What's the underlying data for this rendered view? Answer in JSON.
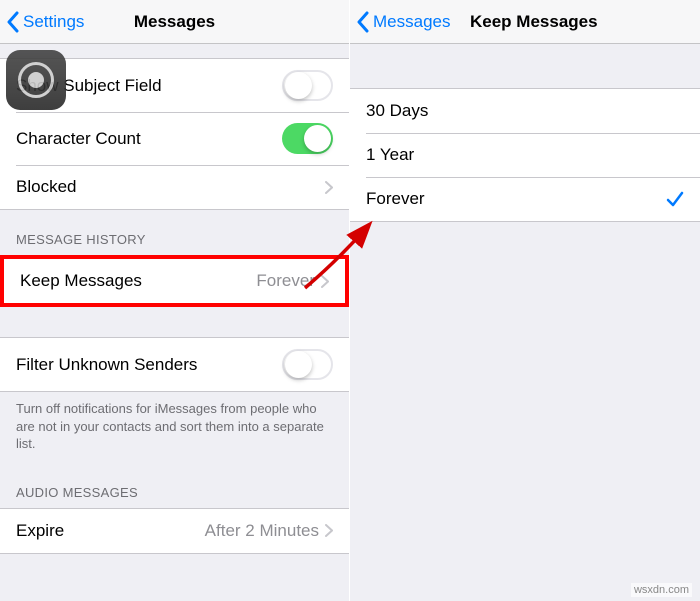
{
  "left": {
    "nav": {
      "back": "Settings",
      "title": "Messages"
    },
    "rows": {
      "subject": "Show Subject Field",
      "charcount": "Character Count",
      "blocked": "Blocked"
    },
    "history": {
      "header": "MESSAGE HISTORY",
      "keep": {
        "label": "Keep Messages",
        "value": "Forever"
      }
    },
    "filter": {
      "label": "Filter Unknown Senders",
      "footer": "Turn off notifications for iMessages from people who are not in your contacts and sort them into a separate list."
    },
    "audio": {
      "header": "AUDIO MESSAGES",
      "expire": {
        "label": "Expire",
        "value": "After 2 Minutes"
      }
    }
  },
  "right": {
    "nav": {
      "back": "Messages",
      "title": "Keep Messages"
    },
    "options": {
      "opt1": "30 Days",
      "opt2": "1 Year",
      "opt3": "Forever"
    }
  },
  "watermark": "wsxdn.com"
}
